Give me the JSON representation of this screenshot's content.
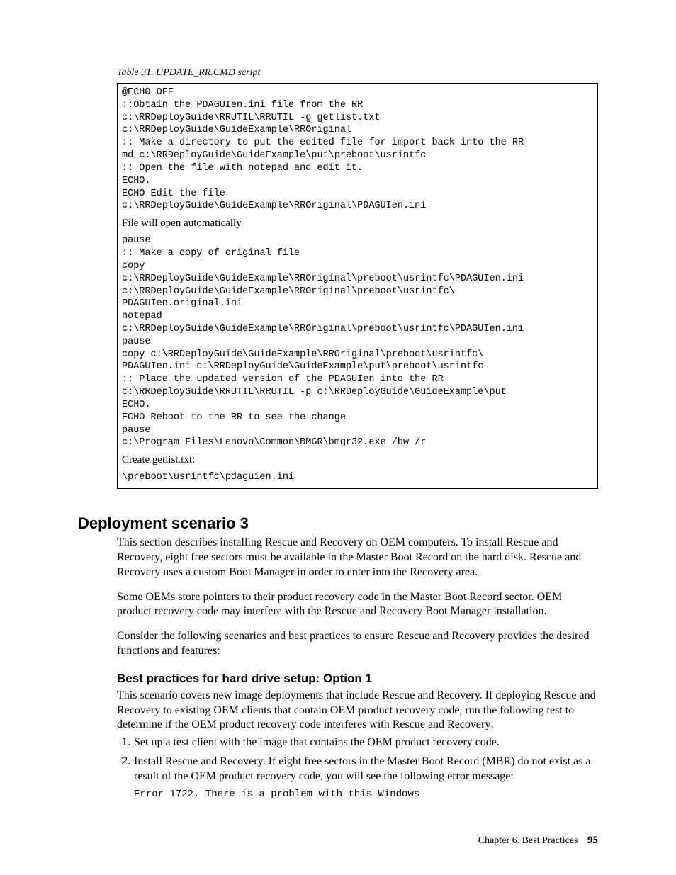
{
  "table_caption": "Table 31. UPDATE_RR.CMD script",
  "code": {
    "block1": "@ECHO OFF\n::Obtain the PDAGUIen.ini file from the RR\nc:\\RRDeployGuide\\RRUTIL\\RRUTIL -g getlist.txt\nc:\\RRDeployGuide\\GuideExample\\RROriginal\n:: Make a directory to put the edited file for import back into the RR\nmd c:\\RRDeployGuide\\GuideExample\\put\\preboot\\usrintfc\n:: Open the file with notepad and edit it.\nECHO.\nECHO Edit the file\nc:\\RRDeployGuide\\GuideExample\\RROriginal\\PDAGUIen.ini",
    "plain1": "File will open automatically",
    "block2": "pause\n:: Make a copy of original file\ncopy\nc:\\RRDeployGuide\\GuideExample\\RROriginal\\preboot\\usrintfc\\PDAGUIen.ini\nc:\\RRDeployGuide\\GuideExample\\RROriginal\\preboot\\usrintfc\\\nPDAGUIen.original.ini\nnotepad\nc:\\RRDeployGuide\\GuideExample\\RROriginal\\preboot\\usrintfc\\PDAGUIen.ini\npause\ncopy c:\\RRDeployGuide\\GuideExample\\RROriginal\\preboot\\usrintfc\\\nPDAGUIen.ini c:\\RRDeployGuide\\GuideExample\\put\\preboot\\usrintfc\n:: Place the updated version of the PDAGUIen into the RR\nc:\\RRDeployGuide\\RRUTIL\\RRUTIL -p c:\\RRDeployGuide\\GuideExample\\put\nECHO.\nECHO Reboot to the RR to see the change\npause\nc:\\Program Files\\Lenovo\\Common\\BMGR\\bmgr32.exe /bw /r",
    "plain2": "Create getlist.txt:",
    "block3": "\\preboot\\usrintfc\\pdaguien.ini"
  },
  "heading": "Deployment scenario 3",
  "para1": "This section describes installing Rescue and Recovery on OEM computers. To install Rescue and Recovery, eight free sectors must be available in the Master Boot Record on the hard disk. Rescue and Recovery uses a custom Boot Manager in order to enter into the Recovery area.",
  "para2": "Some OEMs store pointers to their product recovery code in the Master Boot Record sector. OEM product recovery code may interfere with the Rescue and Recovery Boot Manager installation.",
  "para3": "Consider the following scenarios and best practices to ensure Rescue and Recovery provides the desired functions and features:",
  "subheading": "Best practices for hard drive setup: Option 1",
  "sub_intro": "This scenario covers new image deployments that include Rescue and Recovery. If deploying Rescue and Recovery to existing OEM clients that contain OEM product recovery code, run the following test to determine if the OEM product recovery code interferes with Rescue and Recovery:",
  "step1": "Set up a test client with the image that contains the OEM product recovery code.",
  "step2": "Install Rescue and Recovery. If eight free sectors in the Master Boot Record (MBR) do not exist as a result of the OEM product recovery code, you will see the following error message:",
  "error_code": "Error 1722. There is a problem with this Windows",
  "footer_chapter": "Chapter 6. Best Practices",
  "footer_page": "95"
}
